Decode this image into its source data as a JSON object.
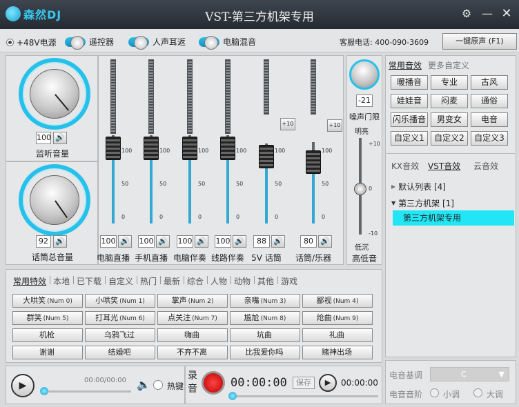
{
  "app": {
    "logo_text": "森然DJ",
    "title": "VST-第三方机架专用"
  },
  "toolbar": {
    "phantom_label": "+48V电源",
    "toggles": [
      {
        "label": "遥控器"
      },
      {
        "label": "人声耳返"
      },
      {
        "label": "电脑混音"
      }
    ],
    "hotline": "客服电话: 400-090-3609",
    "restore_label": "一键原声 (F1)"
  },
  "monitor": {
    "value": "100",
    "label": "监听音量"
  },
  "mic_master": {
    "value": "92",
    "label": "话筒总音量"
  },
  "channels": [
    {
      "value": "100",
      "label": "电脑直播",
      "level": 0.34
    },
    {
      "value": "100",
      "label": "手机直播",
      "level": 0.34
    },
    {
      "value": "100",
      "label": "电脑伴奏",
      "level": 0.34
    },
    {
      "value": "100",
      "label": "线路伴奏",
      "level": 0.34
    },
    {
      "value": "88",
      "label": "5V 话筒",
      "level": 0.42,
      "boost": "+10"
    },
    {
      "value": "80",
      "label": "话筒/乐器",
      "level": 0.5,
      "boost": "+10"
    }
  ],
  "scale": {
    "top": "100",
    "mid": "50",
    "bottom": "0"
  },
  "gate": {
    "value": "-21",
    "label": "噪声门限",
    "bright": "明亮",
    "dark": "低沉",
    "eq_label": "高低音",
    "scale_top": "+10",
    "scale_mid": "0",
    "scale_bottom": "-10"
  },
  "effects": {
    "tabs": [
      "常用音效",
      "更多自定义"
    ],
    "buttons": [
      "暖播音",
      "专业",
      "古风",
      "娃娃音",
      "闷麦",
      "通俗",
      "闪乐播音",
      "男变女",
      "电音",
      "自定义1",
      "自定义2",
      "自定义3"
    ]
  },
  "vst": {
    "tabs": [
      "KX音效",
      "VST音效",
      "云音效"
    ],
    "tree": [
      {
        "label": "默认列表 [4]"
      },
      {
        "label": "第三方机架 [1]"
      }
    ],
    "selected": "第三方机架专用"
  },
  "sfx": {
    "tabs": [
      "常用特效",
      "本地",
      "已下载",
      "自定义",
      "热门",
      "最新",
      "综合",
      "人物",
      "动物",
      "其他",
      "游戏"
    ],
    "buttons": [
      {
        "name": "大哄笑",
        "key": "(Num 0)"
      },
      {
        "name": "小哄笑",
        "key": "(Num 1)"
      },
      {
        "name": "掌声",
        "key": "(Num 2)"
      },
      {
        "name": "亲嘴",
        "key": "(Num 3)"
      },
      {
        "name": "鄙视",
        "key": "(Num 4)"
      },
      {
        "name": "群笑",
        "key": "(Num 5)"
      },
      {
        "name": "打耳光",
        "key": "(Num 6)"
      },
      {
        "name": "点关注",
        "key": "(Num 7)"
      },
      {
        "name": "尴尬",
        "key": "(Num 8)"
      },
      {
        "name": "炝曲",
        "key": "(Num 9)"
      },
      {
        "name": "机枪",
        "key": ""
      },
      {
        "name": "乌鸦飞过",
        "key": ""
      },
      {
        "name": "嗨曲",
        "key": ""
      },
      {
        "name": "坑曲",
        "key": ""
      },
      {
        "name": "礼曲",
        "key": ""
      },
      {
        "name": "谢谢",
        "key": ""
      },
      {
        "name": "结婚吧",
        "key": ""
      },
      {
        "name": "不弃不离",
        "key": ""
      },
      {
        "name": "比我爱你吗",
        "key": ""
      },
      {
        "name": "赌神出场",
        "key": ""
      }
    ]
  },
  "player": {
    "time": "00:00/00:00",
    "hotkey": "热键",
    "record": "录音",
    "rec_time": "00:00:00",
    "save": "保存",
    "play_time": "00:00:00"
  },
  "key": {
    "base_label": "电音基调",
    "base_value": "C",
    "scale_label": "电音音阶",
    "minor": "小调",
    "major": "大调"
  }
}
